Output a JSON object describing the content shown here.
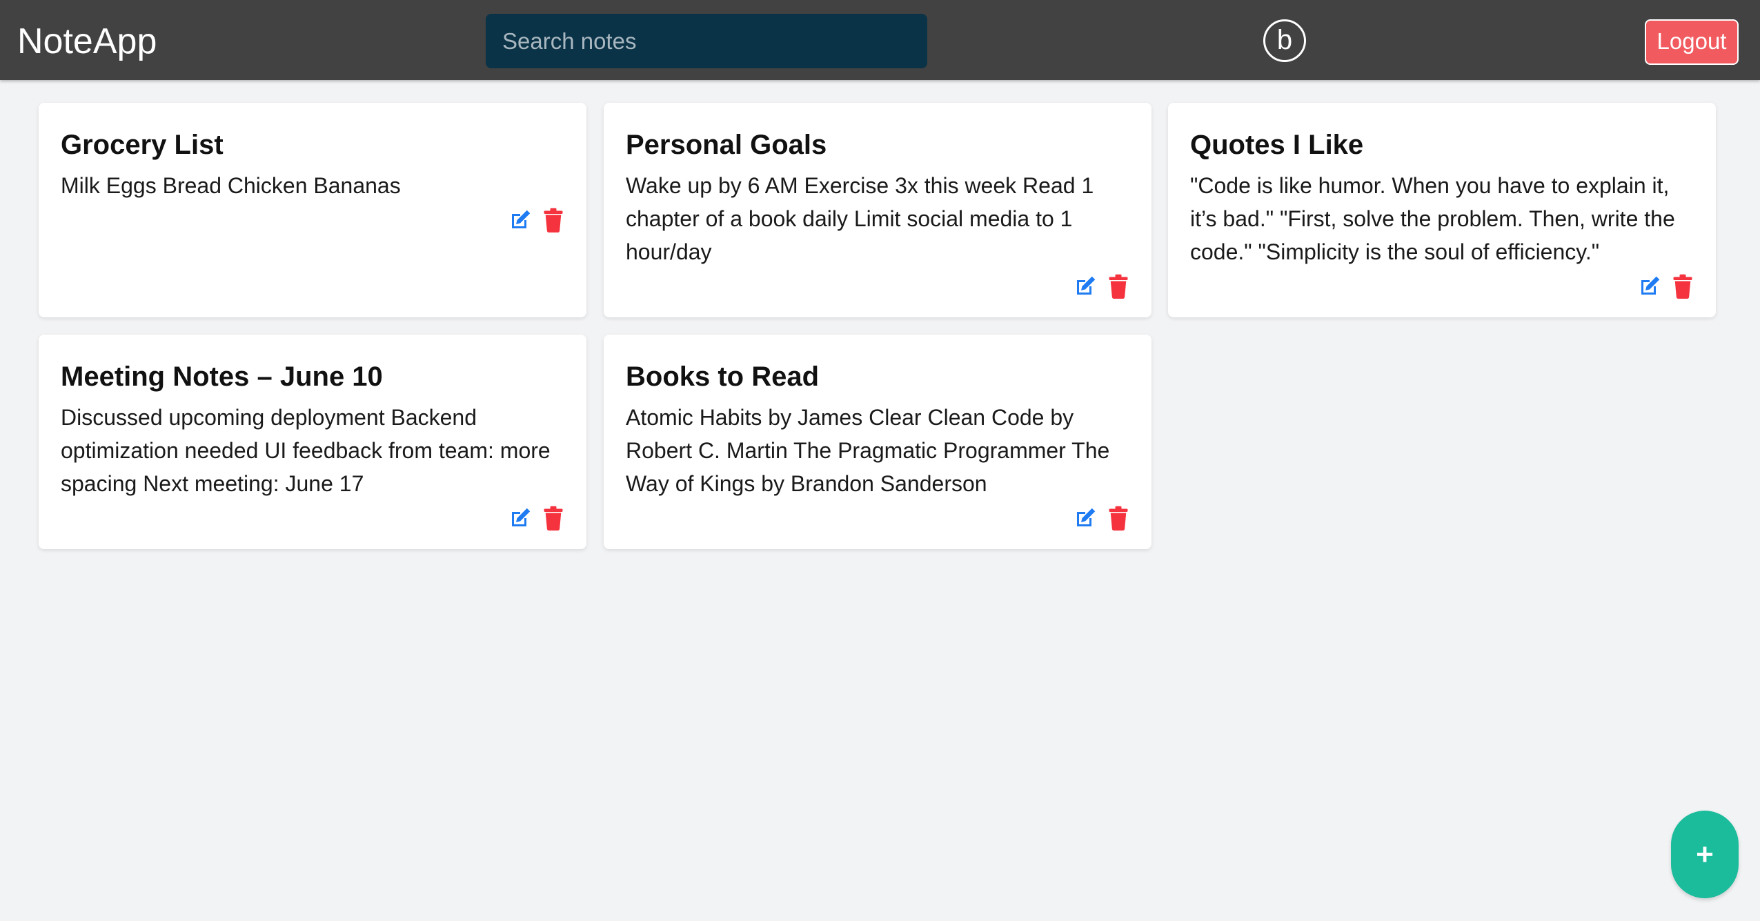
{
  "navbar": {
    "brand": "NoteApp",
    "search_placeholder": "Search notes",
    "avatar_letter": "b",
    "logout_label": "Logout"
  },
  "notes": [
    {
      "title": "Grocery List",
      "body": "Milk Eggs Bread Chicken Bananas"
    },
    {
      "title": "Personal Goals",
      "body": "Wake up by 6 AM Exercise 3x this week Read 1 chapter of a book daily Limit social media to 1 hour/day"
    },
    {
      "title": "Quotes I Like",
      "body": "\"Code is like humor. When you have to explain it, it’s bad.\" \"First, solve the problem. Then, write the code.\" \"Simplicity is the soul of efficiency.\""
    },
    {
      "title": "Meeting Notes – June 10",
      "body": "Discussed upcoming deployment Backend optimization needed UI feedback from team: more spacing Next meeting: June 17"
    },
    {
      "title": "Books to Read",
      "body": "Atomic Habits by James Clear Clean Code by Robert C. Martin The Pragmatic Programmer The Way of Kings by Brandon Sanderson"
    }
  ],
  "fab_label": "+",
  "colors": {
    "navbar": "#424242",
    "search_bg": "#0a3347",
    "logout": "#f15a5f",
    "edit": "#1e7bf2",
    "delete": "#f5333f",
    "fab": "#1abc9c",
    "background": "#f2f3f5"
  },
  "icons": {
    "edit": "edit-icon",
    "delete": "trash-icon"
  }
}
